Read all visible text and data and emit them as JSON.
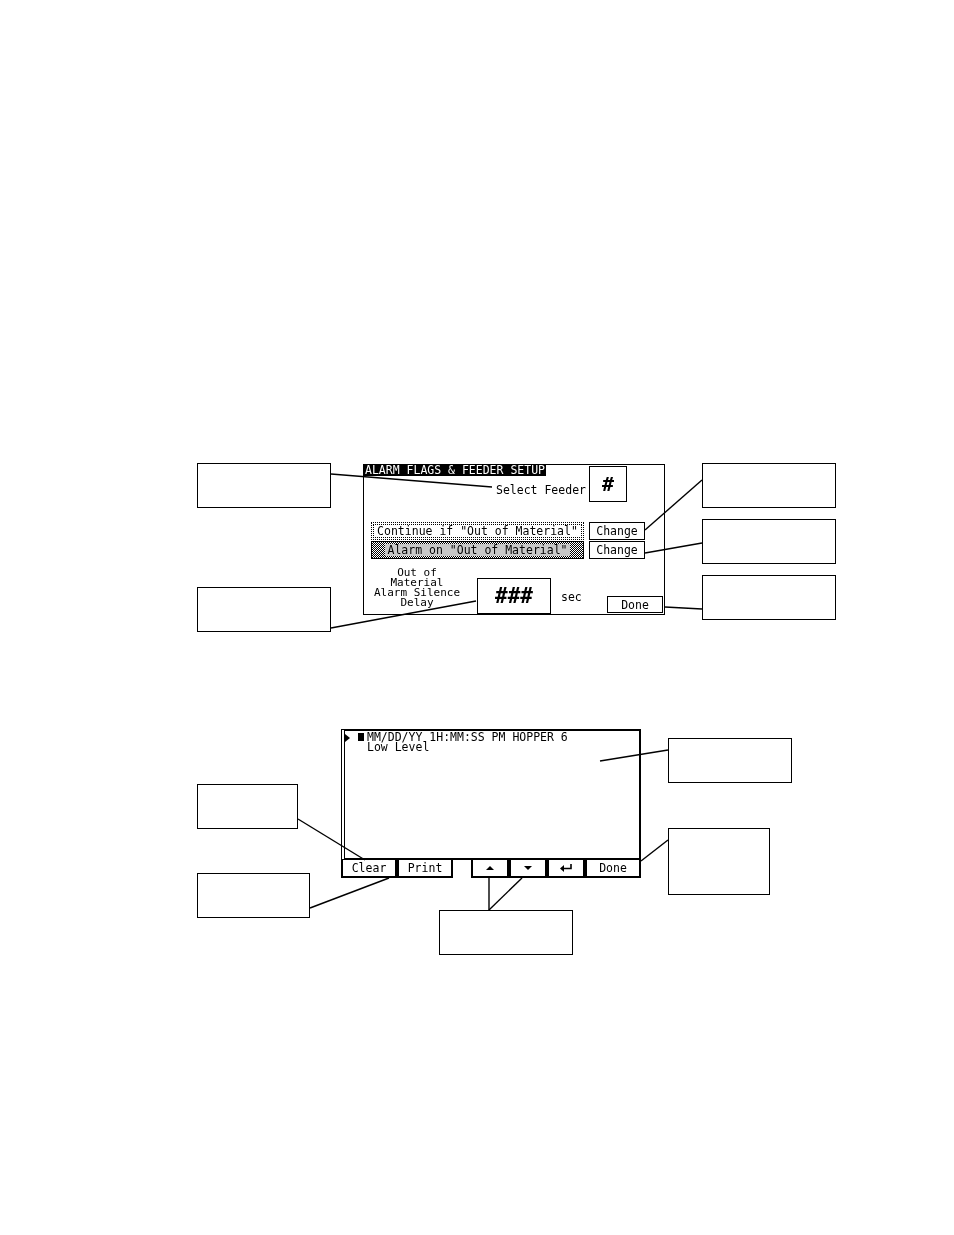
{
  "figures": [
    {
      "kind": "alarm_setup",
      "title": "ALARM FLAGS & FEEDER SETUP",
      "feeder_label": "Select Feeder",
      "feeder_value": "#",
      "options": [
        {
          "label": "Continue if \"Out of Material\"",
          "selected": false,
          "button": "Change"
        },
        {
          "label": "Alarm on \"Out of Material\"",
          "selected": true,
          "button": "Change"
        }
      ],
      "delay_label": "Out of Material Alarm Silence Delay",
      "delay_value": "###",
      "delay_unit": "sec",
      "done_button": "Done"
    },
    {
      "kind": "alarm_log",
      "entries": [
        {
          "selected": true,
          "header": "MM/DD/YY 1H:MM:SS PM HOPPER 6",
          "message": "Low Level"
        }
      ],
      "left_buttons": [
        {
          "kind": "text",
          "label": "Clear"
        },
        {
          "kind": "text",
          "label": "Print"
        }
      ],
      "right_buttons": [
        {
          "kind": "up"
        },
        {
          "kind": "down"
        },
        {
          "kind": "enter"
        },
        {
          "kind": "text",
          "label": "Done"
        }
      ]
    }
  ]
}
